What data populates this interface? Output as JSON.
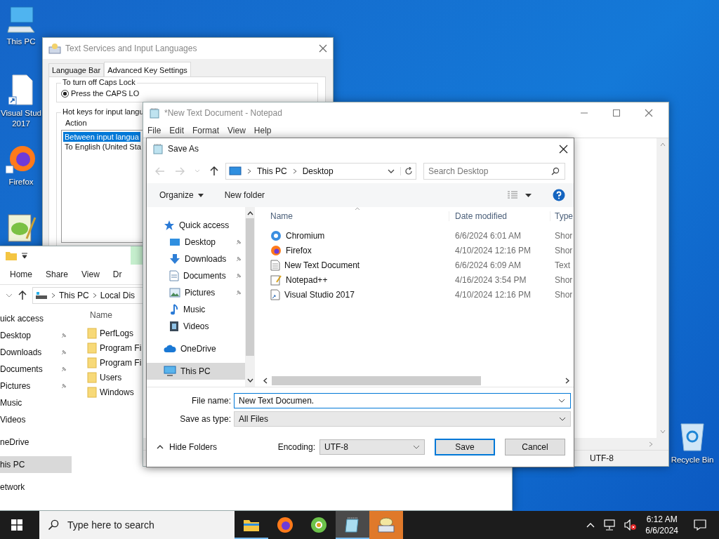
{
  "desktop_icons": [
    {
      "kind": "computer",
      "lines": [
        "This PC"
      ]
    },
    {
      "kind": "shortcut-file",
      "lines": [
        "Visual Stud",
        "2017"
      ]
    },
    {
      "kind": "browser",
      "lines": [
        "Firefox"
      ]
    },
    {
      "kind": "notepad"
    }
  ],
  "recycle_bin": {
    "label": "Recycle Bin"
  },
  "text_services": {
    "title": "Text Services and Input Languages",
    "tabs": [
      {
        "label": "Language Bar",
        "selected": false
      },
      {
        "label": "Advanced Key Settings",
        "selected": true
      }
    ],
    "caps_group": {
      "title": "To turn off Caps Lock",
      "option": {
        "label": "Press the CAPS LO",
        "selected": true
      }
    },
    "hotkeys_group": {
      "title": "Hot keys for input langu",
      "column": "Action",
      "items": [
        {
          "label": "Between input langua",
          "selected": true
        },
        {
          "label": "To English (United Sta",
          "selected": false
        }
      ]
    }
  },
  "explorer": {
    "ribbon_tabs": [
      "Home",
      "Share",
      "View",
      "Dr"
    ],
    "address": [
      "This PC",
      "Local Dis"
    ],
    "nav": [
      {
        "label": "uick access",
        "pinned": false,
        "selected": false
      },
      {
        "label": "Desktop",
        "pinned": true,
        "selected": false
      },
      {
        "label": "Downloads",
        "pinned": true,
        "selected": false
      },
      {
        "label": "Documents",
        "pinned": true,
        "selected": false
      },
      {
        "label": "Pictures",
        "pinned": true,
        "selected": false
      },
      {
        "label": "Music",
        "pinned": false,
        "selected": false
      },
      {
        "label": "Videos",
        "pinned": false,
        "selected": false
      },
      {
        "label": "neDrive",
        "pinned": false,
        "selected": false
      },
      {
        "label": "his PC",
        "pinned": false,
        "selected": true
      },
      {
        "label": "etwork",
        "pinned": false,
        "selected": false
      }
    ],
    "column": "Name",
    "folders": [
      "PerfLogs",
      "Program Fi",
      "Program Fi",
      "Users",
      "Windows"
    ]
  },
  "notepad": {
    "title": "*New Text Document - Notepad",
    "menu": [
      "File",
      "Edit",
      "Format",
      "View",
      "Help"
    ],
    "status_encoding": "UTF-8"
  },
  "save_as": {
    "title": "Save As",
    "address": [
      "This PC",
      "Desktop"
    ],
    "search": {
      "placeholder": "Search Desktop"
    },
    "toolbar": {
      "organize": "Organize",
      "new_folder": "New folder"
    },
    "nav": [
      {
        "kind": "star",
        "label": "Quick access",
        "pinned": false,
        "selected": false,
        "group_start": true
      },
      {
        "kind": "desktop",
        "label": "Desktop",
        "pinned": true,
        "selected": false,
        "group_start": false
      },
      {
        "kind": "download",
        "label": "Downloads",
        "pinned": true,
        "selected": false,
        "group_start": false
      },
      {
        "kind": "document",
        "label": "Documents",
        "pinned": true,
        "selected": false,
        "group_start": false
      },
      {
        "kind": "picture",
        "label": "Pictures",
        "pinned": true,
        "selected": false,
        "group_start": false
      },
      {
        "kind": "music",
        "label": "Music",
        "pinned": false,
        "selected": false,
        "group_start": false
      },
      {
        "kind": "video",
        "label": "Videos",
        "pinned": false,
        "selected": false,
        "group_start": false
      },
      {
        "kind": "cloud",
        "label": "OneDrive",
        "pinned": false,
        "selected": false,
        "group_start": true
      },
      {
        "kind": "computer",
        "label": "This PC",
        "pinned": false,
        "selected": true,
        "group_start": true
      }
    ],
    "columns": [
      "Name",
      "Date modified",
      "Type"
    ],
    "files": [
      {
        "kind": "globe",
        "name": "Chromium",
        "date": "6/6/2024 6:01 AM",
        "type": "Shor"
      },
      {
        "kind": "browser",
        "name": "Firefox",
        "date": "4/10/2024 12:16 PM",
        "type": "Shor"
      },
      {
        "kind": "text",
        "name": "New Text Document",
        "date": "6/6/2024 6:09 AM",
        "type": "Text"
      },
      {
        "kind": "notepad",
        "name": "Notepad++",
        "date": "4/16/2024 3:54 PM",
        "type": "Shor"
      },
      {
        "kind": "shortcut",
        "name": "Visual Studio 2017",
        "date": "4/10/2024 12:16 PM",
        "type": "Shor"
      }
    ],
    "file_name": {
      "label": "File name:",
      "value": "New Text Documen."
    },
    "save_type": {
      "label": "Save as type:",
      "value": "All Files"
    },
    "hide_folders": "Hide Folders",
    "encoding": {
      "label": "Encoding:",
      "value": "UTF-8"
    },
    "buttons": [
      {
        "label": "Save",
        "default": true
      },
      {
        "label": "Cancel",
        "default": false
      }
    ]
  },
  "taskbar": {
    "search": {
      "placeholder": "Type here to search"
    },
    "apps": [
      {
        "kind": "folder",
        "running": true,
        "active": false,
        "attention": false
      },
      {
        "kind": "browser",
        "running": false,
        "active": false,
        "attention": false
      },
      {
        "kind": "globe",
        "running": false,
        "active": false,
        "attention": false
      },
      {
        "kind": "notepad",
        "running": true,
        "active": true,
        "attention": false
      },
      {
        "kind": "keyboard",
        "running": false,
        "active": false,
        "attention": true
      }
    ],
    "time": "6:12 AM",
    "date": "6/6/2024"
  }
}
